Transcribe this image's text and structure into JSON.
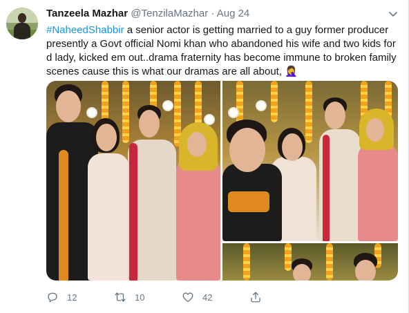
{
  "tweet": {
    "author_name": "Tanzeela Mazhar",
    "author_handle": "@TenzilaMazhar",
    "separator": "·",
    "date": "Aug 24",
    "hashtag": "#NaheedShabbir",
    "body": " a senior actor is getting married to a guy former producer presently a Govt official Nomi khan who abandoned his wife and two kids for d lady, kicked em out..drama fraternity has become immune to broken family scenes cause this is what our dramas are all about, 🤦‍♀️"
  },
  "actions": {
    "reply_count": "12",
    "retweet_count": "10",
    "like_count": "42"
  },
  "icons": {
    "menu": "chevron-down-icon",
    "reply": "reply-icon",
    "retweet": "retweet-icon",
    "like": "heart-icon",
    "share": "share-icon"
  },
  "colors": {
    "link": "#1b95e0",
    "secondary_text": "#657786",
    "primary_text": "#14171a"
  }
}
